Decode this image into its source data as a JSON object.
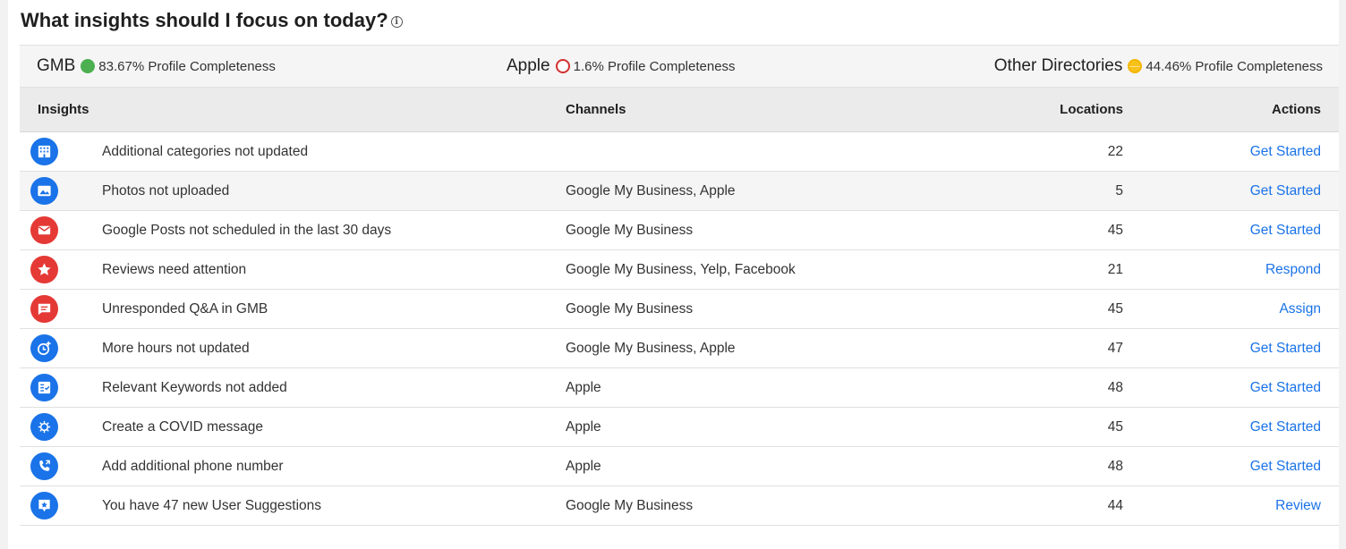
{
  "header": {
    "title": "What insights should I focus on today?",
    "info_icon": "info-icon"
  },
  "summary": [
    {
      "name": "GMB",
      "status": "filled",
      "color": "#4caf50",
      "completeness": "83.67% Profile Completeness"
    },
    {
      "name": "Apple",
      "status": "empty",
      "color": "#d32f2f",
      "completeness": "1.6% Profile Completeness"
    },
    {
      "name": "Other Directories",
      "status": "half",
      "color": "#f9c21b",
      "completeness": "44.46% Profile Completeness"
    }
  ],
  "table": {
    "columns": {
      "insights": "Insights",
      "channels": "Channels",
      "locations": "Locations",
      "actions": "Actions"
    },
    "rows": [
      {
        "icon": "building-icon",
        "icon_color": "#1a73e8",
        "insight": "Additional categories not updated",
        "channels": "",
        "locations": "22",
        "action": "Get Started"
      },
      {
        "icon": "photo-icon",
        "icon_color": "#1a73e8",
        "insight": "Photos not uploaded",
        "channels": "Google My Business, Apple",
        "locations": "5",
        "action": "Get Started"
      },
      {
        "icon": "mail-icon",
        "icon_color": "#e53935",
        "insight": "Google Posts not scheduled in the last 30 days",
        "channels": "Google My Business",
        "locations": "45",
        "action": "Get Started"
      },
      {
        "icon": "star-icon",
        "icon_color": "#e53935",
        "insight": "Reviews need attention",
        "channels": "Google My Business, Yelp, Facebook",
        "locations": "21",
        "action": "Respond"
      },
      {
        "icon": "chat-icon",
        "icon_color": "#e53935",
        "insight": "Unresponded Q&A in GMB",
        "channels": "Google My Business",
        "locations": "45",
        "action": "Assign"
      },
      {
        "icon": "clock-plus-icon",
        "icon_color": "#1a73e8",
        "insight": "More hours not updated",
        "channels": "Google My Business, Apple",
        "locations": "47",
        "action": "Get Started"
      },
      {
        "icon": "checklist-icon",
        "icon_color": "#1a73e8",
        "insight": "Relevant Keywords not added",
        "channels": "Apple",
        "locations": "48",
        "action": "Get Started"
      },
      {
        "icon": "virus-icon",
        "icon_color": "#1a73e8",
        "insight": "Create a COVID message",
        "channels": "Apple",
        "locations": "45",
        "action": "Get Started"
      },
      {
        "icon": "phone-icon",
        "icon_color": "#1a73e8",
        "insight": "Add additional phone number",
        "channels": "Apple",
        "locations": "48",
        "action": "Get Started"
      },
      {
        "icon": "suggestion-icon",
        "icon_color": "#1a73e8",
        "insight": "You have 47 new User Suggestions",
        "channels": "Google My Business",
        "locations": "44",
        "action": "Review"
      }
    ]
  }
}
